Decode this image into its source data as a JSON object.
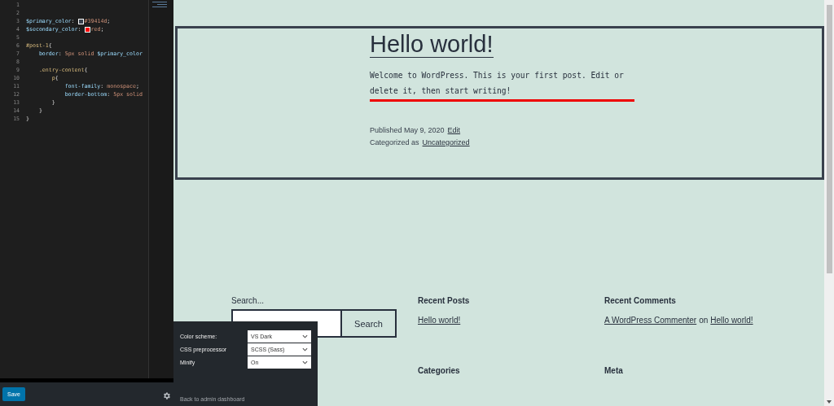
{
  "editor": {
    "lines": [
      {
        "number": "1"
      },
      {
        "number": "2"
      },
      {
        "number": "3",
        "segments": [
          {
            "kind": "var",
            "text": "$primary_color"
          },
          {
            "kind": "punct",
            "text": ":"
          },
          {
            "kind": "swatch",
            "color": "#39414d"
          },
          {
            "kind": "val",
            "text": "#39414d"
          },
          {
            "kind": "punct",
            "text": ";"
          }
        ]
      },
      {
        "number": "4",
        "segments": [
          {
            "kind": "var",
            "text": "$secondary_color"
          },
          {
            "kind": "punct",
            "text": ":"
          },
          {
            "kind": "swatch",
            "color": "#ff0000"
          },
          {
            "kind": "val",
            "text": "red"
          },
          {
            "kind": "punct",
            "text": ";"
          }
        ]
      },
      {
        "number": "5"
      },
      {
        "number": "6",
        "segments": [
          {
            "kind": "sel",
            "text": "#post-1"
          },
          {
            "kind": "punct",
            "text": "{"
          }
        ]
      },
      {
        "number": "7",
        "segments": [
          {
            "kind": "prop",
            "text": "    border"
          },
          {
            "kind": "punct",
            "text": ":"
          },
          {
            "kind": "val",
            "text": " 5px solid "
          },
          {
            "kind": "var",
            "text": "$primary_color"
          }
        ]
      },
      {
        "number": "8"
      },
      {
        "number": "9",
        "segments": [
          {
            "kind": "sel",
            "text": "    .entry-content"
          },
          {
            "kind": "punct",
            "text": "{"
          }
        ]
      },
      {
        "number": "10",
        "segments": [
          {
            "kind": "sel",
            "text": "        p"
          },
          {
            "kind": "punct",
            "text": "{"
          }
        ]
      },
      {
        "number": "11",
        "segments": [
          {
            "kind": "prop",
            "text": "            font-family"
          },
          {
            "kind": "punct",
            "text": ":"
          },
          {
            "kind": "val",
            "text": " monospace"
          },
          {
            "kind": "punct",
            "text": ";"
          }
        ]
      },
      {
        "number": "12",
        "segments": [
          {
            "kind": "prop",
            "text": "            border-bottom"
          },
          {
            "kind": "punct",
            "text": ":"
          },
          {
            "kind": "val",
            "text": " 5px solid"
          }
        ]
      },
      {
        "number": "13",
        "segments": [
          {
            "kind": "punct",
            "text": "        }"
          }
        ]
      },
      {
        "number": "14",
        "segments": [
          {
            "kind": "punct",
            "text": "    }"
          }
        ]
      },
      {
        "number": "15",
        "segments": [
          {
            "kind": "punct",
            "text": "}"
          }
        ]
      }
    ]
  },
  "save_button": "Save",
  "settings_panel": {
    "fields": [
      {
        "label": "Color scheme:",
        "value": "VS Dark"
      },
      {
        "label": "CSS preprocessor",
        "value": "SCSS (Sass)"
      },
      {
        "label": "Minify",
        "value": "On"
      }
    ],
    "back_link": "Back to admin dashboard"
  },
  "post": {
    "title": "Hello world!",
    "content": "Welcome to WordPress. This is your first post. Edit or delete it, then start writing!",
    "published": "Published May 9, 2020",
    "edit_link": "Edit",
    "categorized_label": "Categorized as",
    "category_link": "Uncategorized"
  },
  "footer": {
    "search_label": "Search...",
    "search_button": "Search",
    "recent_posts": {
      "title": "Recent Posts",
      "links": [
        "Hello world!"
      ]
    },
    "recent_comments": {
      "title": "Recent Comments",
      "author": "A WordPress Commenter",
      "on": "on",
      "post": "Hello world!"
    },
    "categories": {
      "title": "Categories"
    },
    "meta": {
      "title": "Meta"
    }
  }
}
